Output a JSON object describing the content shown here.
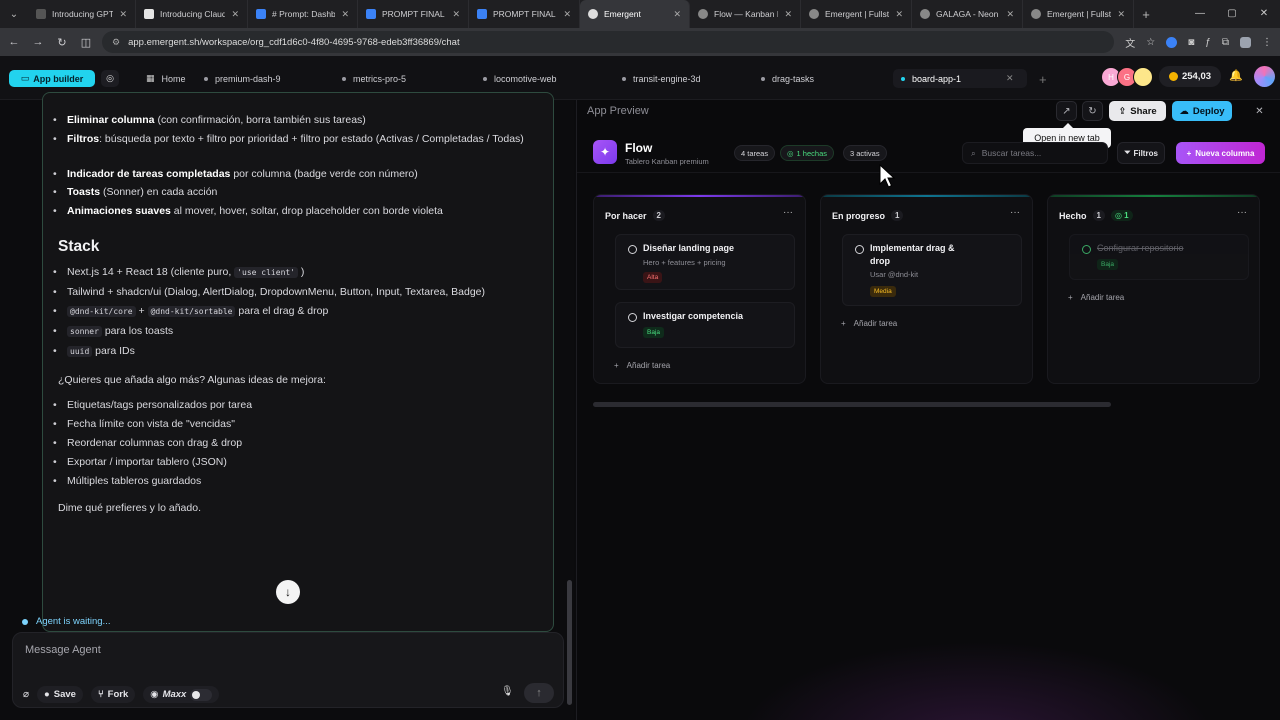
{
  "browser": {
    "tabs": [
      {
        "title": "Introducing GPT-",
        "color": "#555"
      },
      {
        "title": "Introducing Claud",
        "color": "#e5e5e5"
      },
      {
        "title": "# Prompt: Dashb",
        "color": "#3b82f6"
      },
      {
        "title": "PROMPT FINAL T",
        "color": "#3b82f6"
      },
      {
        "title": "PROMPT FINAL T",
        "color": "#3b82f6"
      },
      {
        "title": "Emergent",
        "color": "#ddd"
      },
      {
        "title": "Flow — Kanban P",
        "color": "#888"
      },
      {
        "title": "Emergent | Fullsta",
        "color": "#888"
      },
      {
        "title": "GALAGA - Neon S",
        "color": "#888"
      },
      {
        "title": "Emergent | Fullsta",
        "color": "#888"
      }
    ],
    "url": "app.emergent.sh/workspace/org_cdf1d6c0-4f80-4695-9768-edeb3ff36869/chat"
  },
  "appbar": {
    "app_builder": "App builder",
    "home": "Home",
    "tabs": [
      "premium-dash-9",
      "metrics-pro-5",
      "locomotive-web",
      "transit-engine-3d",
      "drag-tasks",
      "board-app-1"
    ],
    "avatars": [
      "H",
      "G",
      ""
    ],
    "credits": "254,03"
  },
  "chat": {
    "bullets_top": [
      {
        "bold": "Eliminar columna",
        "rest": " (con confirmación, borra también sus tareas)"
      },
      {
        "bold": "Filtros",
        "rest": ": búsqueda por texto + filtro por prioridad + filtro por estado (Activas / Completadas / Todas)"
      },
      {
        "bold": "Indicador de tareas completadas",
        "rest": " por columna (badge verde con número)"
      },
      {
        "bold": "Toasts",
        "rest": " (Sonner) en cada acción"
      },
      {
        "bold": "Animaciones suaves",
        "rest": " al mover, hover, soltar, drop placeholder con borde violeta"
      }
    ],
    "stack_heading": "Stack",
    "stack": {
      "s1_pre": "Next.js 14 + React 18 (cliente puro, ",
      "s1_code": "'use client'",
      "s1_post": " )",
      "s2": "Tailwind + shadcn/ui (Dialog, AlertDialog, DropdownMenu, Button, Input, Textarea, Badge)",
      "s3_code1": "@dnd-kit/core",
      "s3_plus": " + ",
      "s3_code2": "@dnd-kit/sortable",
      "s3_post": " para el drag & drop",
      "s4_code": "sonner",
      "s4_post": " para los toasts",
      "s5_code": "uuid",
      "s5_post": " para IDs"
    },
    "question": "¿Quieres que añada algo más? Algunas ideas de mejora:",
    "ideas": [
      "Etiquetas/tags personalizados por tarea",
      "Fecha límite con vista de \"vencidas\"",
      "Reordenar columnas con drag & drop",
      "Exportar / importar tablero (JSON)",
      "Múltiples tableros guardados"
    ],
    "closing": "Dime qué prefieres y lo añado.",
    "status": "Agent is waiting...",
    "placeholder": "Message Agent",
    "save": "Save",
    "fork": "Fork",
    "maxx": "Maxx"
  },
  "preview": {
    "title": "App Preview",
    "share": "Share",
    "deploy": "Deploy",
    "tooltip": "Open in new tab",
    "app_name": "Flow",
    "app_sub": "Tablero Kanban premium",
    "stats": {
      "tareas": "4 tareas",
      "hechas": "1 hechas",
      "activas": "3 activas"
    },
    "search_placeholder": "Buscar tareas...",
    "filtros": "Filtros",
    "nueva_columna": "Nueva columna",
    "add_task": "Añadir tarea",
    "columns": [
      {
        "title": "Por hacer",
        "count": "2",
        "accent": "#7c3aed"
      },
      {
        "title": "En progreso",
        "count": "1",
        "accent": "#0e7490"
      },
      {
        "title": "Hecho",
        "count": "1",
        "done_count": "1",
        "accent": "#15803d"
      }
    ],
    "cards": {
      "c1_title": "Diseñar landing page",
      "c1_desc": "Hero + features + pricing",
      "c1_badge": "Alta",
      "c2_title": "Investigar competencia",
      "c2_badge": "Baja",
      "c3_title": "Implementar drag & drop",
      "c3_desc": "Usar @dnd-kit",
      "c3_badge": "Media",
      "c4_title": "Configurar repositorio",
      "c4_badge": "Baja"
    }
  }
}
